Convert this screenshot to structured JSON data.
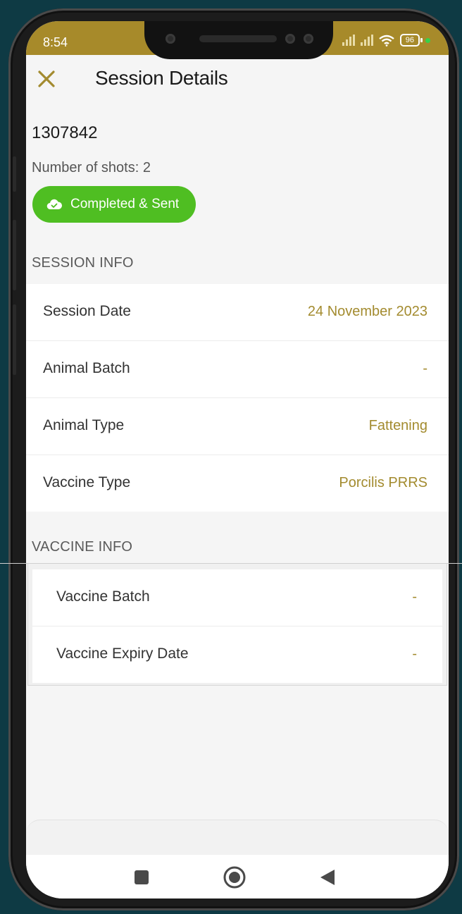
{
  "status_bar": {
    "time": "8:54",
    "battery": "96"
  },
  "header": {
    "title": "Session Details"
  },
  "session": {
    "id": "1307842",
    "shots_text": "Number of shots: 2",
    "status_badge": "Completed & Sent"
  },
  "session_info": {
    "heading": "SESSION INFO",
    "rows": [
      {
        "label": "Session Date",
        "value": "24 November 2023"
      },
      {
        "label": "Animal Batch",
        "value": "-"
      },
      {
        "label": "Animal Type",
        "value": "Fattening"
      },
      {
        "label": "Vaccine Type",
        "value": "Porcilis PRRS"
      }
    ]
  },
  "vaccine_info": {
    "heading": "VACCINE INFO",
    "rows": [
      {
        "label": "Vaccine Batch",
        "value": "-"
      },
      {
        "label": "Vaccine Expiry Date",
        "value": "-"
      }
    ]
  },
  "colors": {
    "accent": "#a38b2f",
    "status_bar": "#a78a2a",
    "badge_green": "#4fbe22"
  },
  "icons": {
    "close": "close-icon",
    "badge": "cloud-check-icon",
    "nav_recents": "square-icon",
    "nav_home": "circle-icon",
    "nav_back": "triangle-back-icon"
  }
}
